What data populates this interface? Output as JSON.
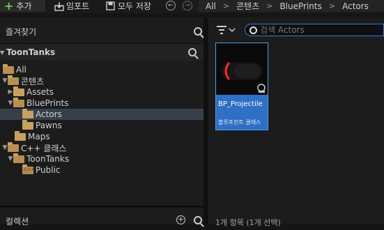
{
  "toolbar": {
    "add_label": "추가",
    "import_label": "임포트",
    "save_all_label": "모두 저장"
  },
  "breadcrumbs": [
    "All",
    "콘텐츠",
    "BluePrints",
    "Actors"
  ],
  "favorites": {
    "title": "즐겨찾기"
  },
  "project": {
    "title": "ToonTanks",
    "tree": [
      {
        "label": "All",
        "arrow": "",
        "selected": false
      },
      {
        "label": "콘텐츠",
        "arrow": "▼",
        "selected": false
      },
      {
        "label": "Assets",
        "arrow": "▶",
        "selected": false
      },
      {
        "label": "BluePrints",
        "arrow": "▼",
        "selected": false
      },
      {
        "label": "Actors",
        "arrow": "",
        "selected": true
      },
      {
        "label": "Pawns",
        "arrow": "",
        "selected": false
      },
      {
        "label": "Maps",
        "arrow": "",
        "selected": false
      },
      {
        "label": "C++ 클래스",
        "arrow": "▼",
        "selected": false
      },
      {
        "label": "ToonTanks",
        "arrow": "▼",
        "selected": false
      },
      {
        "label": "Public",
        "arrow": "",
        "selected": false
      }
    ]
  },
  "collections": {
    "title": "컬렉션"
  },
  "search": {
    "placeholder": "검색 Actors"
  },
  "assets": [
    {
      "name": "BP_Projectile",
      "type": "블루프린트 클래스"
    }
  ],
  "status": "1개 항목 (1개 선택)",
  "colors": {
    "accent": "#2f6fc4",
    "selection": "#37404a",
    "folder": "#c8a060",
    "add_green": "#6bd04a"
  }
}
